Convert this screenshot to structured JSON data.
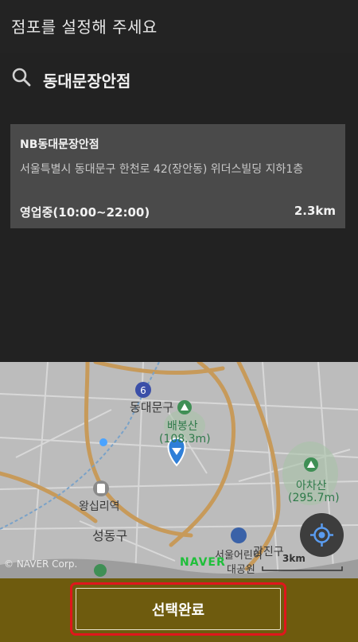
{
  "header": {
    "title": "점포를 설정해 주세요"
  },
  "search": {
    "value": "동대문장안점",
    "icon": "search-icon"
  },
  "store": {
    "name": "NB동대문장안점",
    "address": "서울특별시 동대문구 한천로 42(장안동) 위더스빌딩 지하1층",
    "hours": "영업중(10:00~22:00)",
    "distance": "2.3km"
  },
  "map": {
    "labels": {
      "route": "6",
      "district1": "동대문구",
      "mountain1": "배봉산",
      "mountain1_height": "(108.3m)",
      "station": "왕십리역",
      "district2": "성동구",
      "mountain2": "아차산",
      "mountain2_height": "(295.7m)",
      "park": "서울어린이",
      "park2": "대공원",
      "district3": "광진구"
    },
    "copyright": "© NAVER Corp.",
    "logo": "NAVER",
    "scale": "3km"
  },
  "footer": {
    "confirm_label": "선택완료"
  },
  "colors": {
    "accent": "#6e5b0e",
    "highlight": "#e0161c",
    "pin": "#2f7fd8"
  }
}
